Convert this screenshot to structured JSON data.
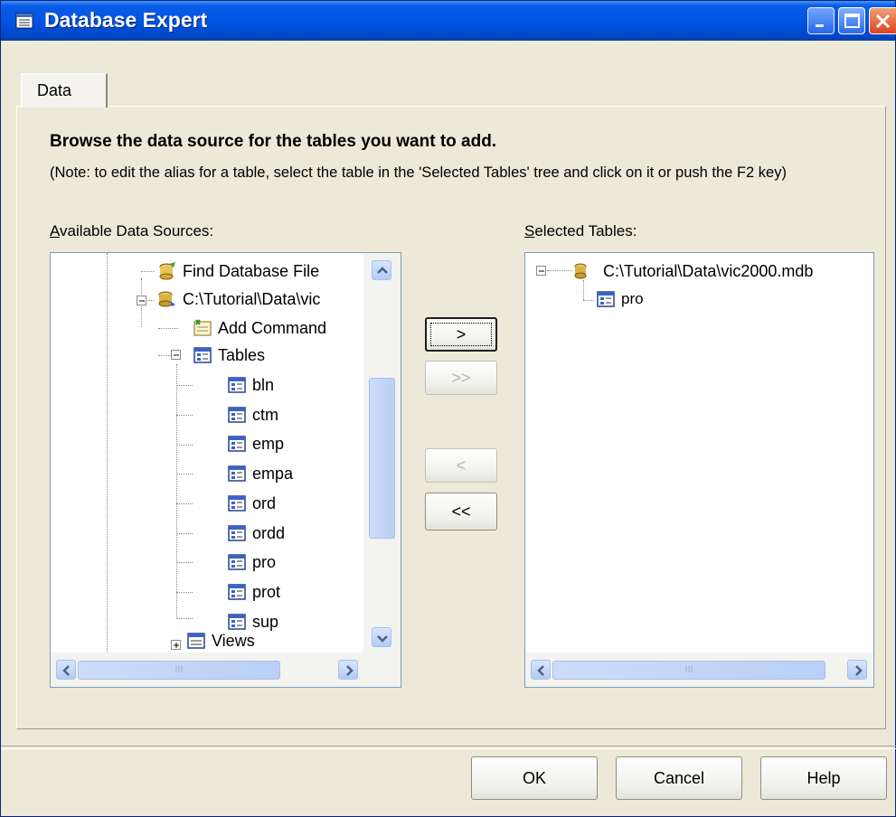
{
  "window": {
    "title": "Database Expert"
  },
  "tabs": [
    {
      "label": "Data"
    }
  ],
  "instructions": {
    "heading": "Browse the data source for the tables you want to add.",
    "note": "(Note: to edit the alias for a table, select the table in the 'Selected Tables' tree and click on it or push the F2 key)"
  },
  "available": {
    "label_prefix": "A",
    "label_rest": "vailable Data Sources:",
    "find_db": "Find Database File",
    "connection": "C:\\Tutorial\\Data\\vic",
    "add_command": "Add Command",
    "tables_label": "Tables",
    "tables": [
      "bln",
      "ctm",
      "emp",
      "empa",
      "ord",
      "ordd",
      "pro",
      "prot",
      "sup"
    ],
    "views_label": "Views",
    "scroll_mid": "III"
  },
  "selected": {
    "label_prefix": "S",
    "label_rest": "elected Tables:",
    "connection": "C:\\Tutorial\\Data\\vic2000.mdb",
    "tables": [
      "pro"
    ],
    "scroll_mid": "III"
  },
  "transfer_buttons": {
    "add_one": ">",
    "add_all": ">>",
    "remove_one": "<",
    "remove_all": "<<"
  },
  "footer": {
    "ok": "OK",
    "cancel": "Cancel",
    "help": "Help"
  },
  "colors": {
    "titlebar": "#0055e5",
    "face": "#ece9d8",
    "close": "#d9441d"
  }
}
